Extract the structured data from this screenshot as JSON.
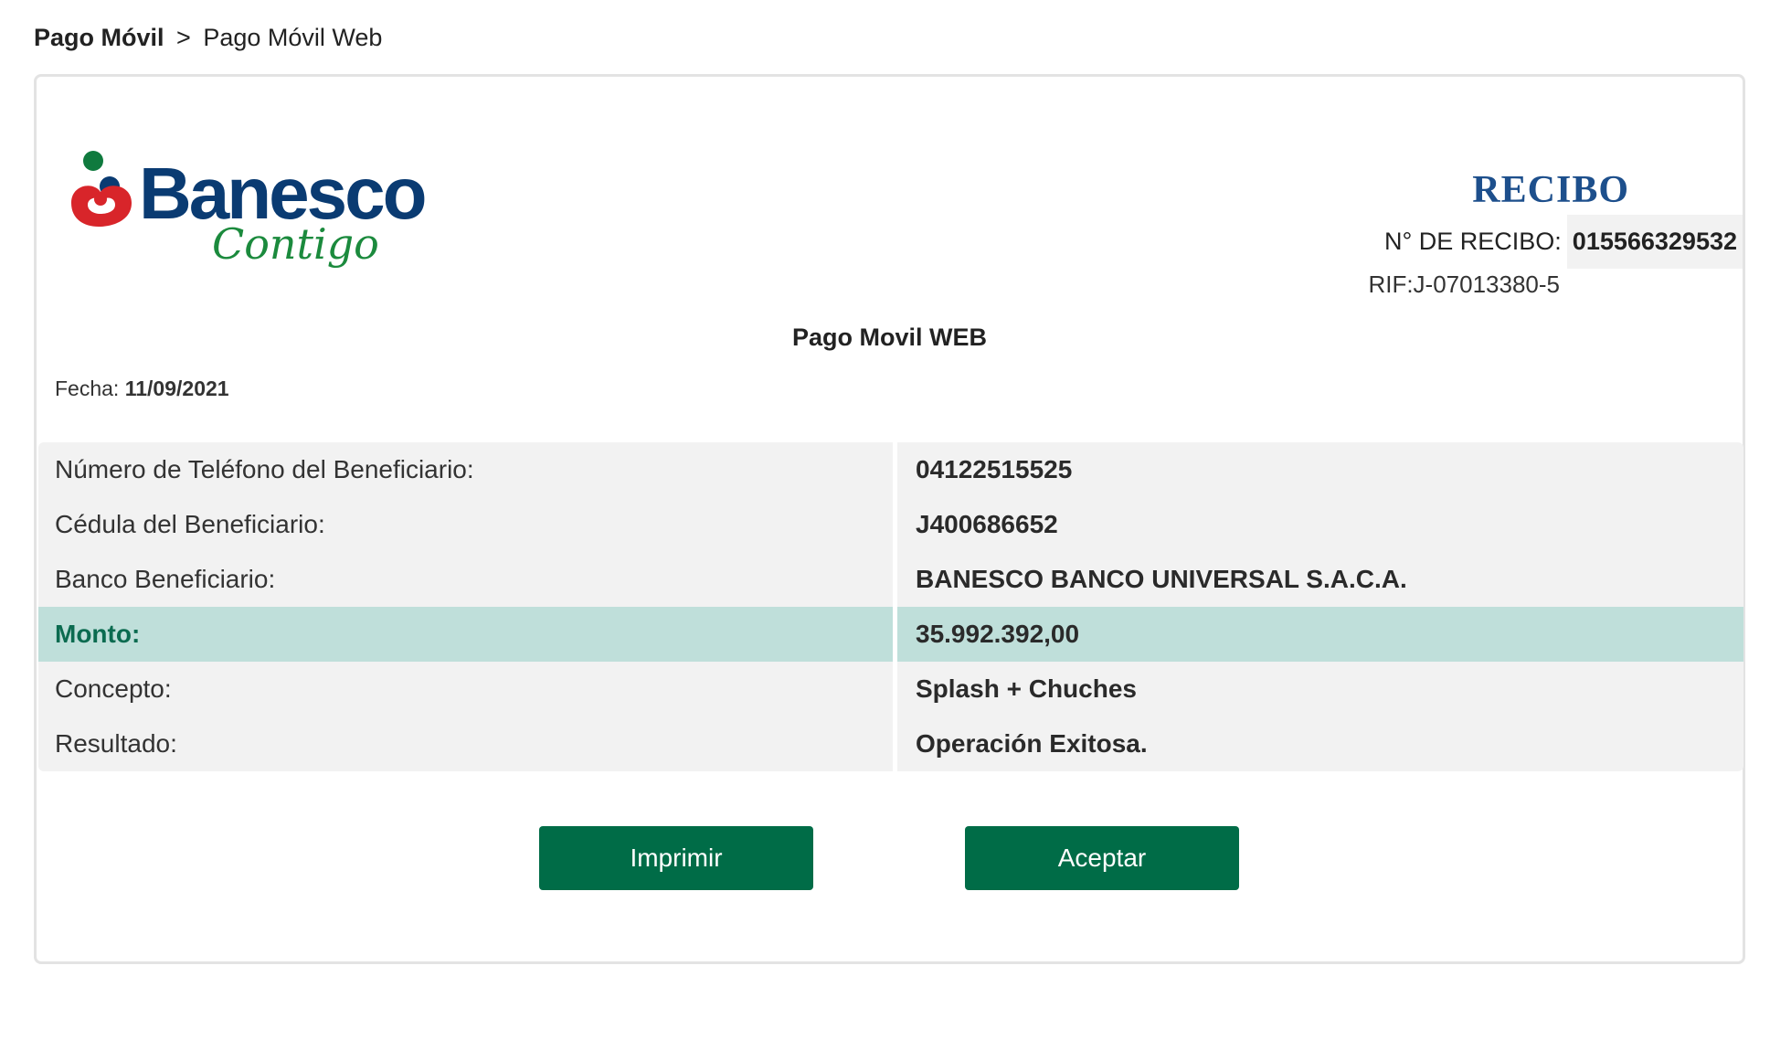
{
  "breadcrumb": {
    "root": "Pago Móvil",
    "separator": ">",
    "current": "Pago Móvil Web"
  },
  "logo": {
    "brand": "Banesco",
    "tagline": "Contigo",
    "colors": {
      "brand_blue": "#0a3b72",
      "brand_red": "#d8252a",
      "brand_green": "#1b8a3d"
    }
  },
  "receipt": {
    "title": "RECIBO",
    "number_label": "N° DE RECIBO:",
    "number_value": "015566329532",
    "rif": "RIF:J-07013380-5",
    "operation_title": "Pago Movil WEB",
    "date_label": "Fecha:",
    "date_value": "11/09/2021"
  },
  "details": [
    {
      "label": "Número de Teléfono del Beneficiario:",
      "value": "04122515525"
    },
    {
      "label": "Cédula del Beneficiario:",
      "value": "J400686652"
    },
    {
      "label": "Banco Beneficiario:",
      "value": "BANESCO BANCO UNIVERSAL S.A.C.A."
    },
    {
      "label": "Monto:",
      "value": "35.992.392,00"
    },
    {
      "label": "Concepto:",
      "value": "Splash + Chuches"
    },
    {
      "label": "Resultado:",
      "value": "Operación Exitosa."
    }
  ],
  "actions": {
    "print_label": "Imprimir",
    "accept_label": "Aceptar"
  },
  "colors": {
    "button_bg": "#006c47",
    "highlight_row_bg": "#bfdfda",
    "highlight_text": "#0b6b50",
    "row_bg": "#f2f2f2"
  }
}
